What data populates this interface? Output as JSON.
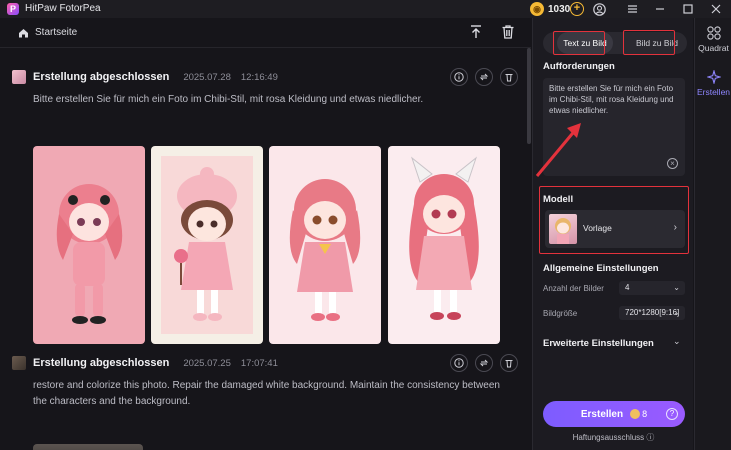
{
  "app": {
    "title": "HitPaw FotorPea",
    "logo": "P",
    "coins": "1030"
  },
  "header": {
    "home_label": "Startseite"
  },
  "cards": [
    {
      "title": "Erstellung abgeschlossen",
      "date": "2025.07.28",
      "time": "12:16:49",
      "prompt": "Bitte erstellen Sie für mich ein Foto im Chibi-Stil, mit rosa Kleidung und etwas niedlicher."
    },
    {
      "title": "Erstellung abgeschlossen",
      "date": "2025.07.25",
      "time": "17:07:41",
      "prompt": "restore and colorize this photo. Repair the damaged white background. Maintain the consistency between the characters and the background."
    }
  ],
  "panel": {
    "tab_text": "Text zu Bild",
    "tab_image": "Bild zu Bild",
    "requirements_title": "Aufforderungen",
    "requirements_value": "Bitte erstellen Sie für mich ein Foto im Chibi-Stil, mit rosa Kleidung und etwas niedlicher.",
    "model_title": "Modell",
    "model_value": "Vorlage",
    "general_title": "Allgemeine Einstellungen",
    "count_label": "Anzahl der Bilder",
    "count_value": "4",
    "size_label": "Bildgröße",
    "size_value": "720*1280[9:16]",
    "advanced_title": "Erweiterte Einstellungen",
    "create_label": "Erstellen",
    "create_cost": "8",
    "disclaimer": "Haftungsausschluss"
  },
  "rail": {
    "items": [
      "Quadrat",
      "Erstellen"
    ]
  },
  "colors": {
    "accent": "#8f86ff",
    "highlight_box": "#e3323c",
    "background": "#16151a"
  }
}
